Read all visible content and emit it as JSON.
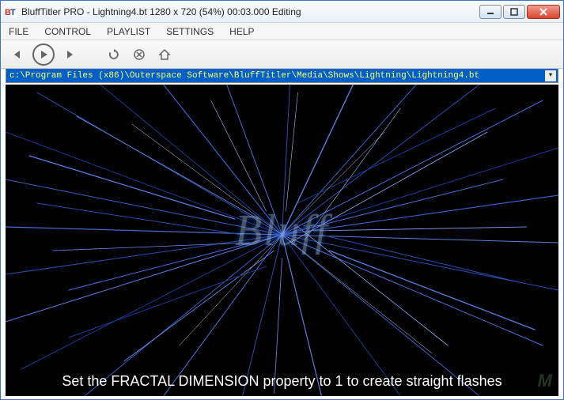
{
  "titlebar": {
    "app_icon_label": "BT",
    "title": "BluffTitler PRO  - Lightning4.bt 1280 x 720 (54%) 00:03.000 Editing"
  },
  "menu": {
    "file": "FILE",
    "control": "CONTROL",
    "playlist": "PLAYLIST",
    "settings": "SETTINGS",
    "help": "HELP"
  },
  "toolbar": {
    "back": "◄",
    "play": "►",
    "forward": "►",
    "reload": "↻",
    "stop": "✕",
    "home": "⌂"
  },
  "pathbar": {
    "path": "c:\\Program Files (x86)\\Outerspace Software\\BluffTitler\\Media\\Shows\\Lightning\\Lightning4.bt",
    "dropdown": "▼"
  },
  "canvas": {
    "center_word": "Bluff",
    "caption": "Set the FRACTAL DIMENSION property to 1 to create straight flashes",
    "watermark": "M"
  }
}
